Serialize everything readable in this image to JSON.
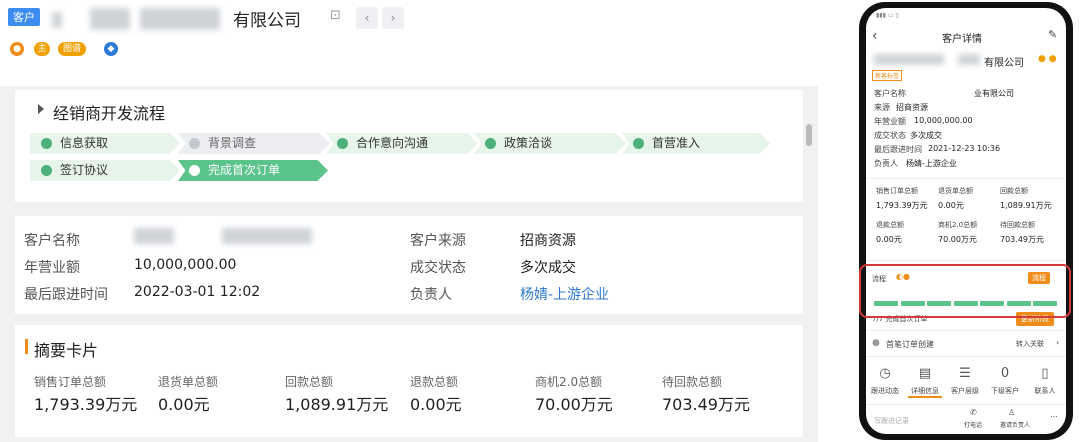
{
  "header": {
    "customer_tag": "客户",
    "company_name_visible": "有限公司",
    "lock_icon": "lock-icon",
    "prev_icon": "‹",
    "next_icon": "›",
    "badges": [
      "主",
      "图谱"
    ]
  },
  "process": {
    "title": "经销商开发流程",
    "steps": [
      {
        "label": "信息获取",
        "state": "done"
      },
      {
        "label": "背景调查",
        "state": "pending"
      },
      {
        "label": "合作意向沟通",
        "state": "done"
      },
      {
        "label": "政策洽谈",
        "state": "done"
      },
      {
        "label": "首营准入",
        "state": "done"
      },
      {
        "label": "签订协议",
        "state": "done"
      },
      {
        "label": "完成首次订单",
        "state": "active"
      }
    ]
  },
  "info": {
    "customer_name_label": "客户名称",
    "revenue_label": "年营业额",
    "revenue_value": "10,000,000.00",
    "last_follow_label": "最后跟进时间",
    "last_follow_value": "2022-03-01 12:02",
    "source_label": "客户来源",
    "source_value": "招商资源",
    "deal_status_label": "成交状态",
    "deal_status_value": "多次成交",
    "owner_label": "负责人",
    "owner_value": "杨婧-上游企业"
  },
  "summary": {
    "title": "摘要卡片",
    "items": [
      {
        "label": "销售订单总额",
        "value": "1,793.39万元"
      },
      {
        "label": "退货单总额",
        "value": "0.00元"
      },
      {
        "label": "回款总额",
        "value": "1,089.91万元"
      },
      {
        "label": "退款总额",
        "value": "0.00元"
      },
      {
        "label": "商机2.0总额",
        "value": "70.00万元"
      },
      {
        "label": "待回款总额",
        "value": "703.49万元"
      }
    ]
  },
  "phone": {
    "title": "客户详情",
    "company_visible": "有限公司",
    "tag": "新客标签",
    "fields": [
      {
        "label": "客户名称",
        "value": "业有限公司"
      },
      {
        "label": "来源",
        "value": "招商资源"
      },
      {
        "label": "年营业额",
        "value": "10,000,000.00"
      },
      {
        "label": "成交状态",
        "value": "多次成交"
      },
      {
        "label": "最后跟进时间",
        "value": "2021-12-23 10:36"
      },
      {
        "label": "负责人",
        "value": "杨婧-上游企业"
      }
    ],
    "stats": [
      {
        "label": "销售订单总额",
        "value": "1,793.39万元"
      },
      {
        "label": "退货单总额",
        "value": "0.00元"
      },
      {
        "label": "回款总额",
        "value": "1,089.91万元"
      },
      {
        "label": "退款总额",
        "value": "0.00元"
      },
      {
        "label": "商机2.0总额",
        "value": "70.00万元"
      },
      {
        "label": "待回款总额",
        "value": "703.49万元"
      }
    ],
    "flow_label": "流程",
    "flow_step": "7/7  完成首次订单",
    "flow_button": "更新阶段",
    "flow_right": "流程",
    "auto_create": "首笔订单创建",
    "auto_create_right": "转入关联",
    "tabs": [
      "跟进动态",
      "详细信息",
      "客户层级",
      "下级客户",
      "联系人"
    ],
    "bottom_input": "写跟进记录",
    "bottom_actions": [
      "打电话",
      "邀请负责人"
    ],
    "progress_fraction": 1.0
  },
  "colors": {
    "accent": "#3d8cf0",
    "step_done": "#e6f4ea",
    "step_active": "#5bc48a",
    "orange": "#f08c1a",
    "highlight": "#d23b3b"
  }
}
